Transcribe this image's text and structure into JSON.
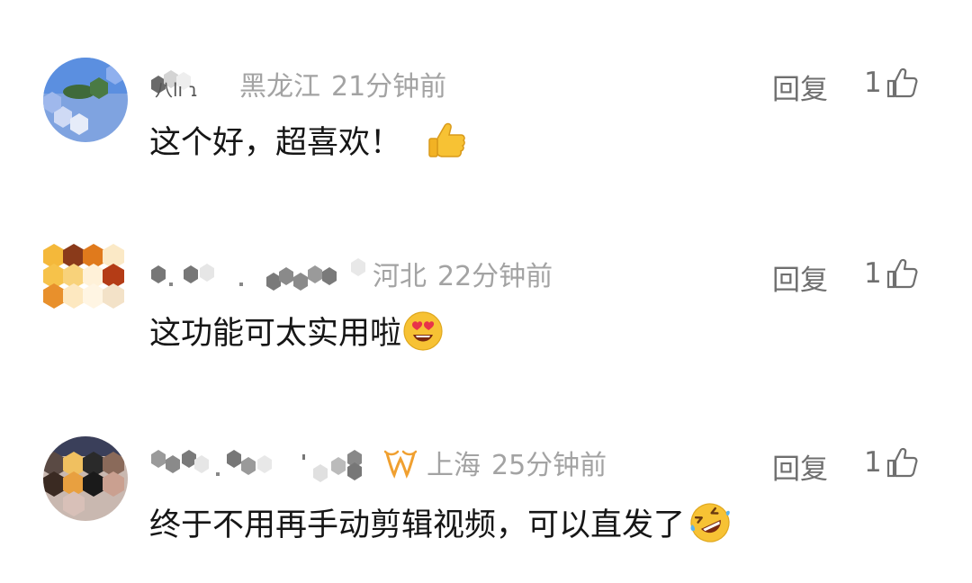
{
  "comments": [
    {
      "location": "黑龙江",
      "time": "21分钟前",
      "text": "这个好，超喜欢！",
      "emoji": "thumbs-up-emoji",
      "reply_label": "回复",
      "likes": "1"
    },
    {
      "location": "河北",
      "time": "22分钟前",
      "text": "这功能可太实用啦",
      "emoji": "heart-eyes-emoji",
      "reply_label": "回复",
      "likes": "1"
    },
    {
      "location": "上海",
      "time": "25分钟前",
      "text": "终于不用再手动剪辑视频，可以直发了",
      "emoji": "rofl-emoji",
      "reply_label": "回复",
      "likes": "1"
    }
  ],
  "colors": {
    "meta_gray": "#a3a3a3",
    "action_gray": "#6f6f6f",
    "badge_orange": "#f0a030"
  }
}
